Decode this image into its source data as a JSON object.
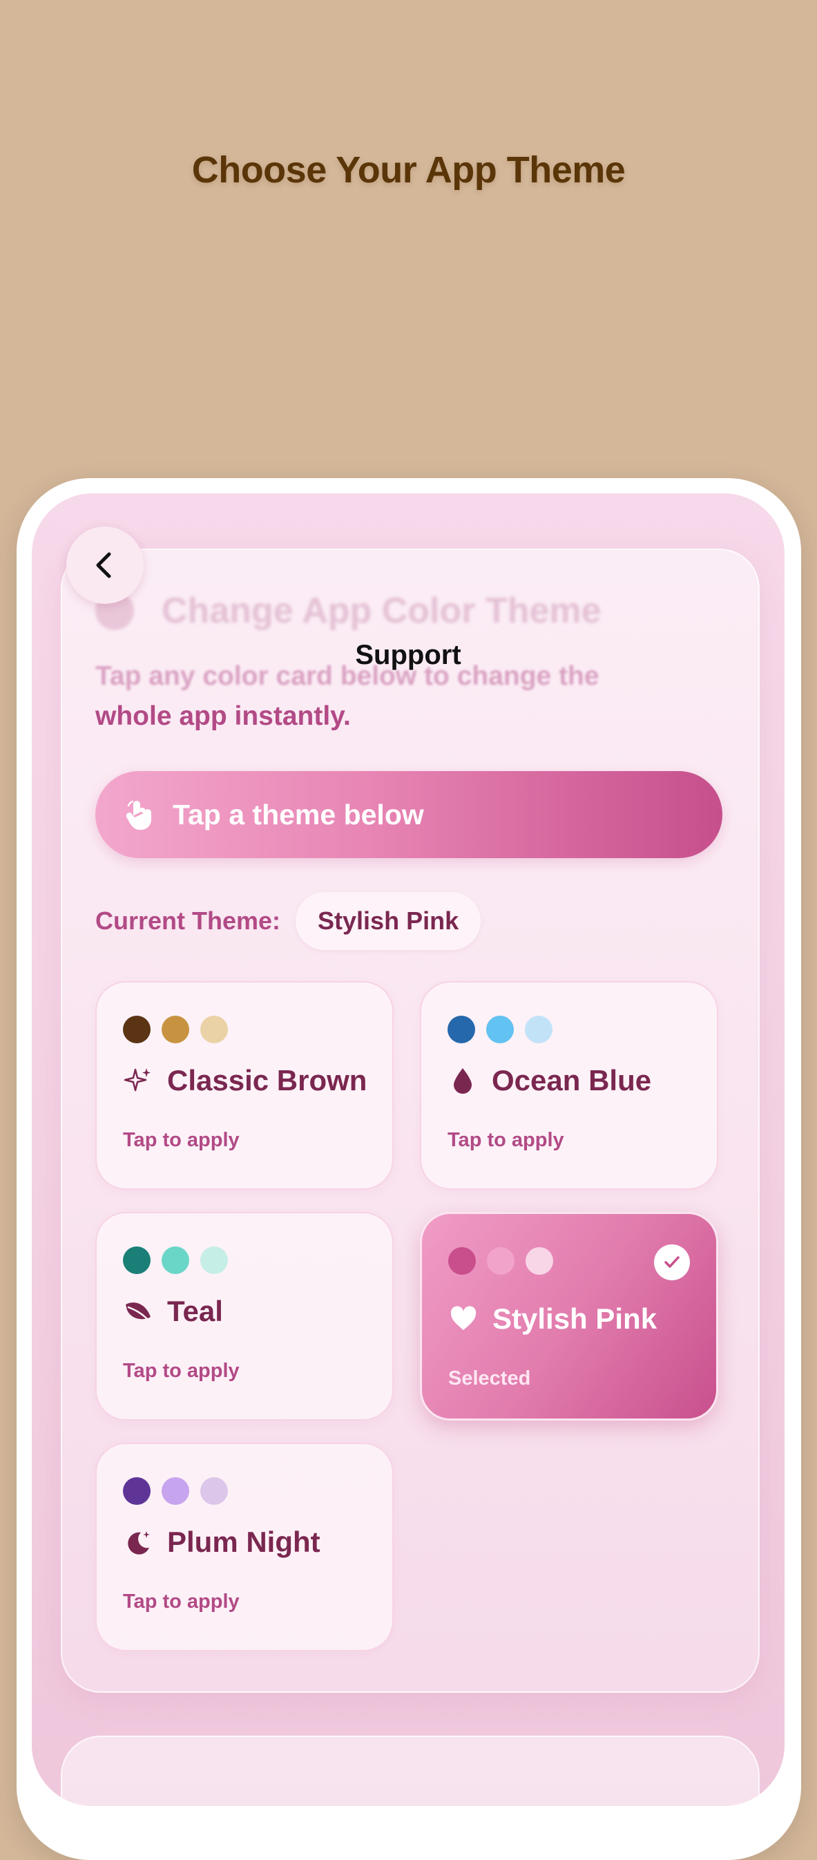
{
  "headline": "Choose Your App Theme",
  "nav": {
    "title": "Support"
  },
  "section": {
    "title": "Change App Color Theme",
    "subtitle_line1": "Tap any color card below to change the",
    "subtitle_line2": "whole app instantly."
  },
  "cta": {
    "label": "Tap a theme below",
    "icon": "hand-tap-icon"
  },
  "current_theme": {
    "label": "Current Theme:",
    "value": "Stylish Pink"
  },
  "themes": [
    {
      "name": "Classic Brown",
      "status": "Tap to apply",
      "icon": "sparkles-icon",
      "colors": [
        "#5a3413",
        "#c89341",
        "#ead2a6"
      ],
      "selected": false
    },
    {
      "name": "Ocean Blue",
      "status": "Tap to apply",
      "icon": "droplet-icon",
      "colors": [
        "#2568ab",
        "#62c2f1",
        "#c2e2f8"
      ],
      "selected": false
    },
    {
      "name": "Teal",
      "status": "Tap to apply",
      "icon": "leaf-icon",
      "colors": [
        "#1a7f77",
        "#6ad6c7",
        "#c5eee6"
      ],
      "selected": false
    },
    {
      "name": "Stylish Pink",
      "status": "Selected",
      "icon": "heart-icon",
      "colors": [
        "#c84e8c",
        "#f2a3c9",
        "#f9d6e7"
      ],
      "selected": true
    },
    {
      "name": "Plum Night",
      "status": "Tap to apply",
      "icon": "moon-stars-icon",
      "colors": [
        "#5e3597",
        "#c7a4ee",
        "#dcc7ea"
      ],
      "selected": false
    }
  ],
  "colors": {
    "background": "#d4b799",
    "accent": "#c84e8c",
    "text_primary": "#7a2750",
    "text_secondary": "#b24a86"
  }
}
